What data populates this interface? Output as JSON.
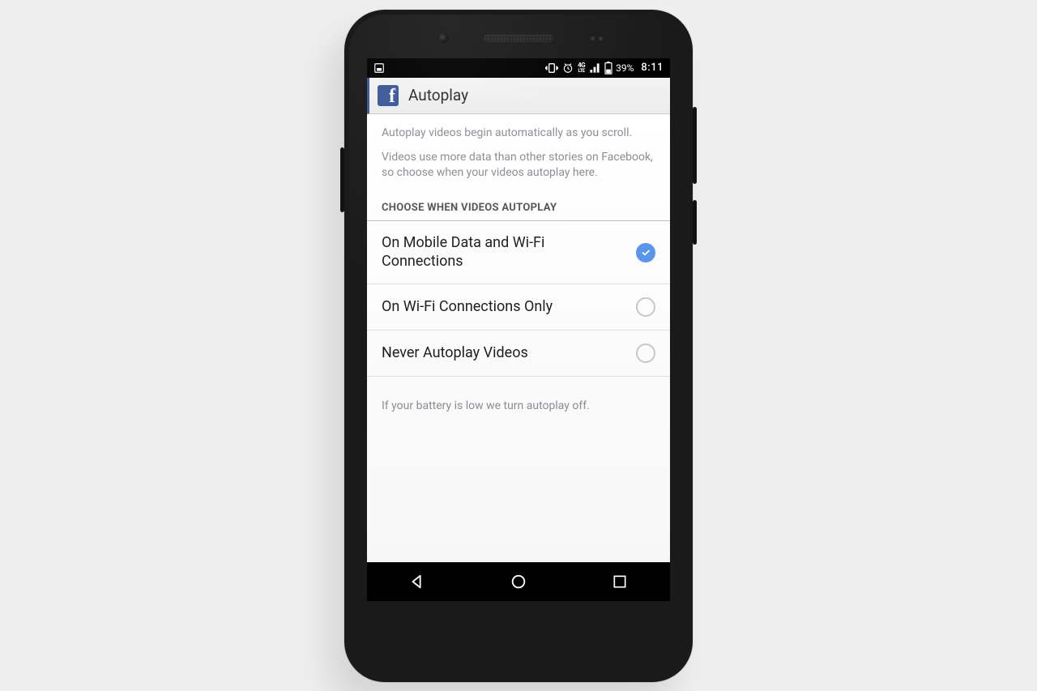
{
  "statusbar": {
    "battery_percent": "39%",
    "time": "8:11",
    "network_label": "4G",
    "network_sub": "LTE"
  },
  "header": {
    "title": "Autoplay"
  },
  "description": {
    "line1": "Autoplay videos begin automatically as you scroll.",
    "line2": "Videos use more data than other stories on Facebook, so choose when your videos autoplay here."
  },
  "section": {
    "title": "CHOOSE WHEN VIDEOS AUTOPLAY"
  },
  "options": [
    {
      "label": "On Mobile Data and Wi-Fi Connections",
      "selected": true
    },
    {
      "label": "On Wi-Fi Connections Only",
      "selected": false
    },
    {
      "label": "Never Autoplay Videos",
      "selected": false
    }
  ],
  "footnote": "If your battery is low we turn autoplay off."
}
